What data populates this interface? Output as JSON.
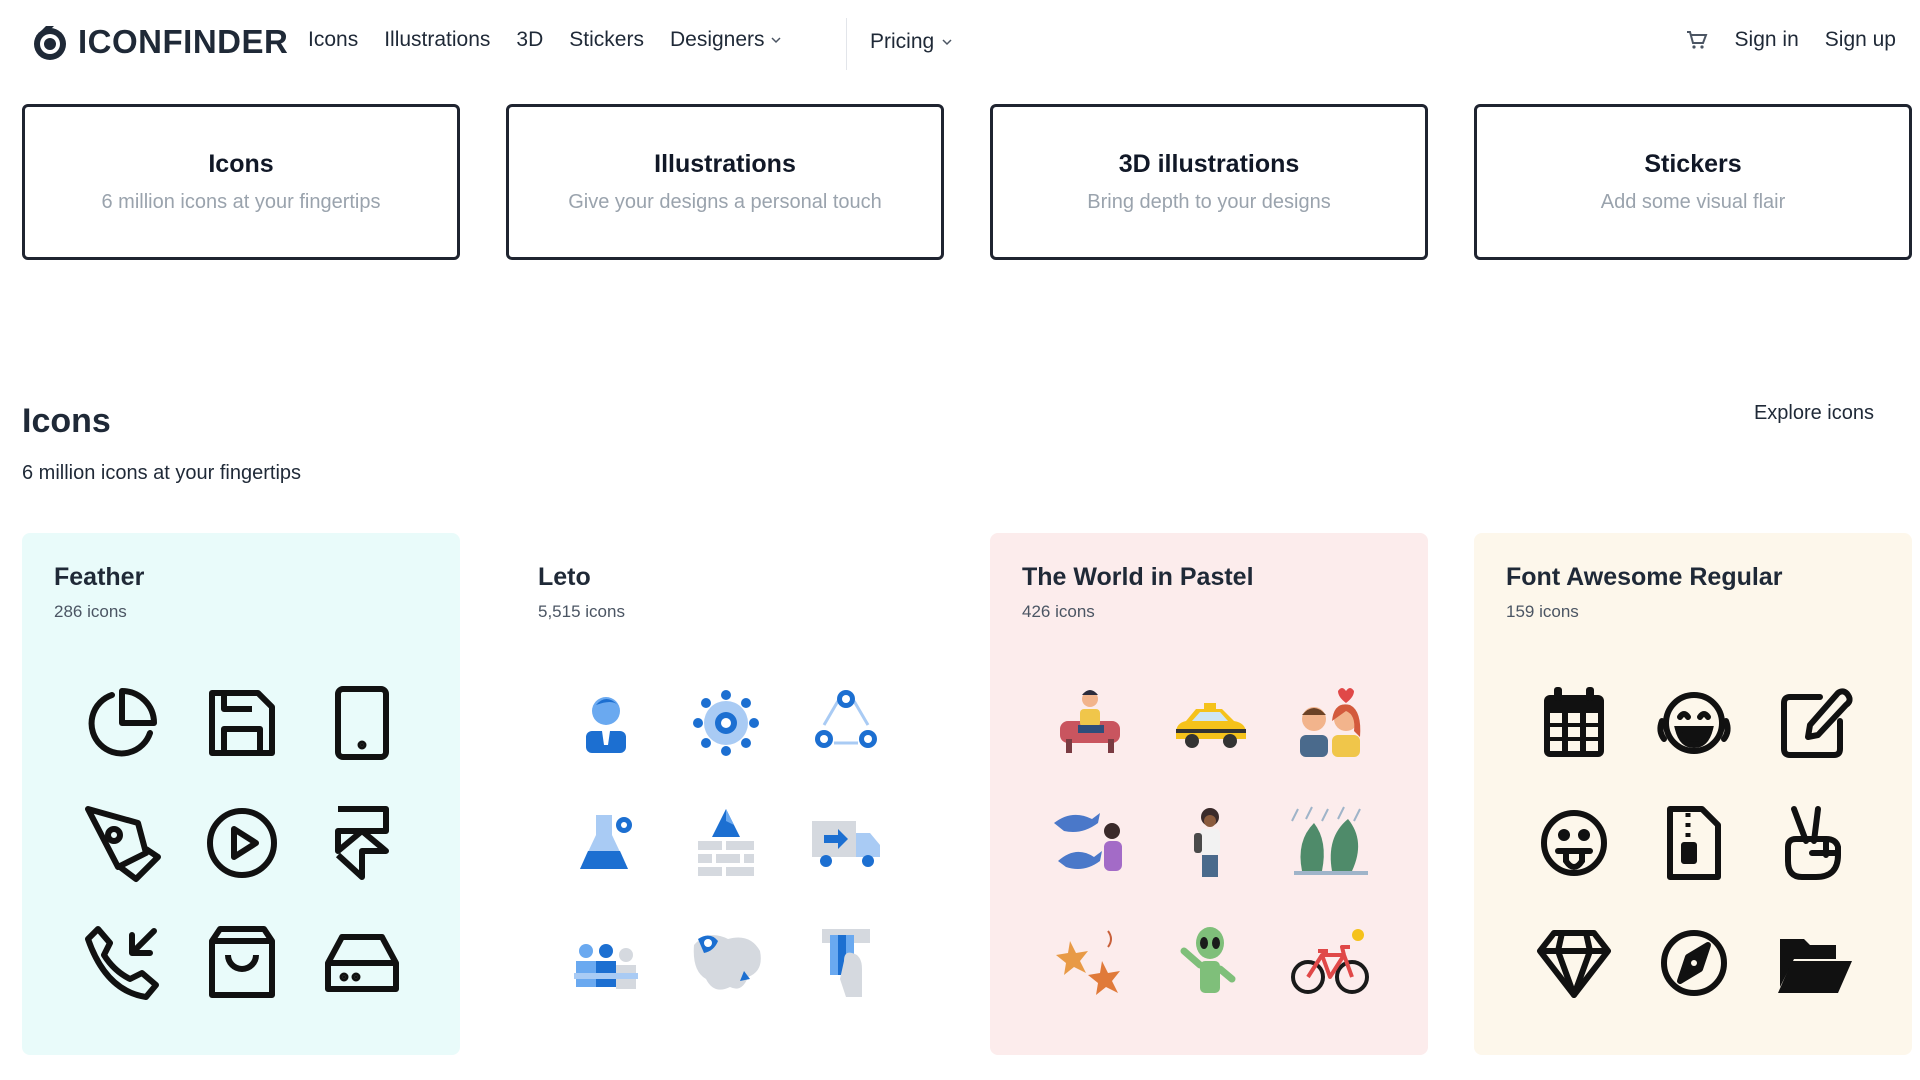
{
  "header": {
    "logo_text": "ICONFINDER",
    "nav": [
      "Icons",
      "Illustrations",
      "3D",
      "Stickers",
      "Designers"
    ],
    "pricing": "Pricing",
    "cart_icon": "cart-icon",
    "sign_in": "Sign in",
    "sign_up": "Sign up"
  },
  "categories": [
    {
      "title": "Icons",
      "subtitle": "6 million icons at your fingertips"
    },
    {
      "title": "Illustrations",
      "subtitle": "Give your designs a personal touch"
    },
    {
      "title": "3D illustrations",
      "subtitle": "Bring depth to your designs"
    },
    {
      "title": "Stickers",
      "subtitle": "Add some visual flair"
    }
  ],
  "section": {
    "title": "Icons",
    "subtitle": "6 million icons at your fingertips",
    "explore": "Explore icons"
  },
  "sets": [
    {
      "name": "Feather",
      "count": "286 icons",
      "bg": "#e9fbfa",
      "icons": [
        "pie-chart-icon",
        "save-icon",
        "tablet-icon",
        "pen-tool-icon",
        "play-circle-icon",
        "framer-icon",
        "phone-incoming-icon",
        "shopping-bag-icon",
        "hard-drive-icon"
      ]
    },
    {
      "name": "Leto",
      "count": "5,515 icons",
      "bg": "#ffffff",
      "icons": [
        "user-icon",
        "settings-icon",
        "share-network-icon",
        "lab-flask-icon",
        "brick-wall-icon",
        "delivery-truck-icon",
        "team-icon",
        "world-map-icon",
        "atm-card-icon"
      ]
    },
    {
      "name": "The World in Pastel",
      "count": "426 icons",
      "bg": "#fcecec",
      "icons": [
        "person-reading-icon",
        "taxi-icon",
        "couple-icon",
        "dolphins-icon",
        "traveler-icon",
        "rainy-forest-icon",
        "autumn-leaves-icon",
        "alien-icon",
        "bicycle-icon"
      ]
    },
    {
      "name": "Font Awesome Regular",
      "count": "159 icons",
      "bg": "#fdf7eb",
      "icons": [
        "calendar-icon",
        "laughing-face-icon",
        "edit-icon",
        "tongue-face-icon",
        "zip-file-icon",
        "peace-hand-icon",
        "gem-icon",
        "compass-icon",
        "folder-open-icon"
      ]
    }
  ]
}
